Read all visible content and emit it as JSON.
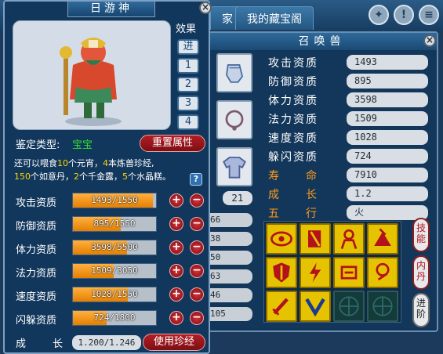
{
  "background_app": {
    "tabs": [
      {
        "label": "家"
      },
      {
        "label": "我的藏宝阁"
      }
    ]
  },
  "main_panel": {
    "title": "日游神",
    "effect_label": "效果",
    "effect_buttons": [
      "进",
      "1",
      "2",
      "3",
      "4"
    ],
    "appraise_label": "鉴定类型:",
    "appraise_value": "宝宝",
    "reset_button": "重置属性",
    "feed_info": {
      "prefix": "还可以喂食",
      "yuanxiao_count": "10",
      "yuanxiao_text": "个元宵，",
      "book_count": "4",
      "book_text": "本炼兽珍经,",
      "ruyi_count": "150",
      "ruyi_text": "个如意丹，",
      "qianjin_count": "2",
      "qianjin_text": "个千金露，",
      "crystal_count": "5",
      "crystal_text": "个水晶糕。"
    },
    "help_icon": "?",
    "attributes": [
      {
        "label": "攻击资质",
        "text": "1493/1550",
        "ratio": 0.963
      },
      {
        "label": "防御资质",
        "text": "895/1550",
        "ratio": 0.577
      },
      {
        "label": "体力资质",
        "text": "3598/5500",
        "ratio": 0.654
      },
      {
        "label": "法力资质",
        "text": "1509/3050",
        "ratio": 0.495
      },
      {
        "label": "速度资质",
        "text": "1028/1550",
        "ratio": 0.663
      },
      {
        "label": "闪躲资质",
        "text": "724/1800",
        "ratio": 0.402
      }
    ],
    "plus": "+",
    "minus": "−",
    "growth_label": "成长",
    "growth_value": "1.200/1.246",
    "use_button": "使用珍经",
    "close": "×"
  },
  "pet_panel": {
    "title": "召唤兽",
    "close": "×",
    "stats": [
      {
        "label": "攻击资质",
        "value": "1493"
      },
      {
        "label": "防御资质",
        "value": "895"
      },
      {
        "label": "体力资质",
        "value": "3598"
      },
      {
        "label": "法力资质",
        "value": "1509"
      },
      {
        "label": "速度资质",
        "value": "1028"
      },
      {
        "label": "躲闪资质",
        "value": "724"
      },
      {
        "label": "寿　　命",
        "value": "7910"
      },
      {
        "label": "成　　长",
        "value": "1.2"
      },
      {
        "label": "五　　行",
        "value": "火"
      }
    ],
    "level_badge": "21",
    "left_values": [
      "66",
      "38",
      "50",
      "63",
      "46",
      "105"
    ],
    "side_buttons": [
      "技能",
      "内丹",
      "进阶"
    ],
    "skills": [
      "fire-eye-skill-icon",
      "book-skill-icon",
      "ghost-skill-icon",
      "thunder-skill-icon",
      "shield-skill-icon",
      "lightning-skill-icon",
      "charm-skill-icon",
      "heart-skill-icon",
      "sword-skill-icon",
      "counter-skill-icon",
      "empty-slot-icon",
      "empty-slot-icon"
    ]
  },
  "colors": {
    "accent_orange": "#ff9b1a",
    "appraise_green": "#32e032",
    "button_red": "#b31d24",
    "number_yellow": "#ffd400"
  }
}
